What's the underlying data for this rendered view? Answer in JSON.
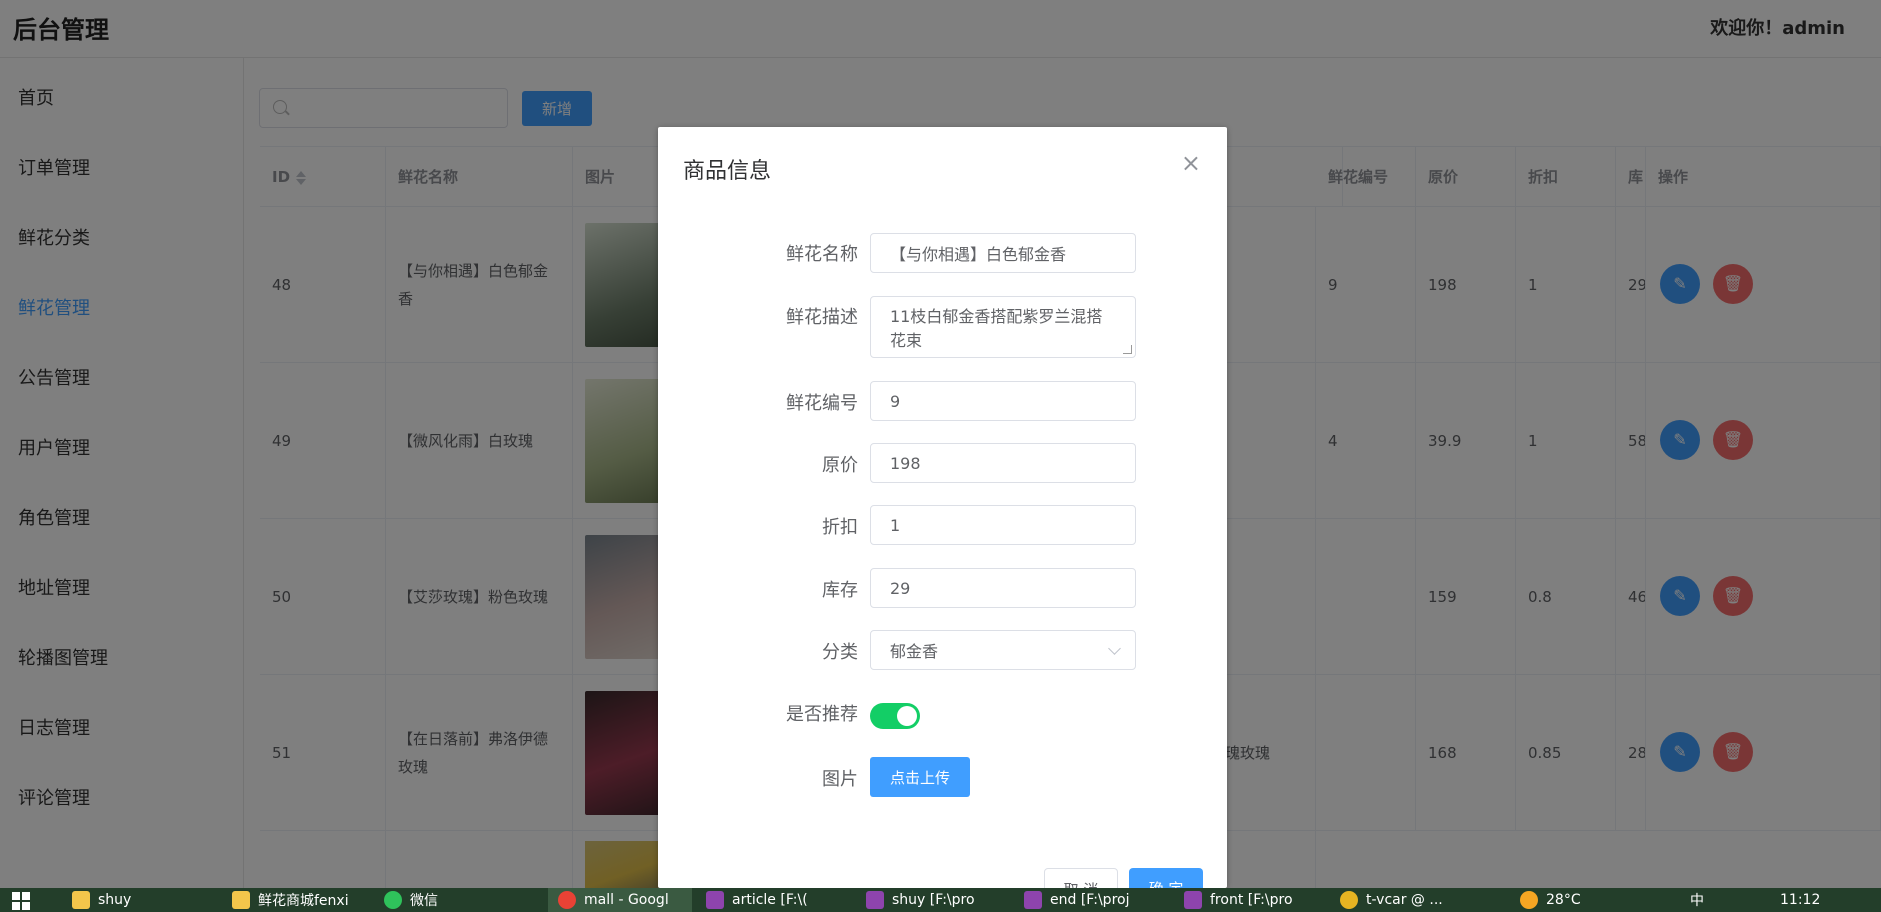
{
  "header": {
    "title": "后台管理",
    "welcome": "欢迎你！admin"
  },
  "sidebar": {
    "items": [
      {
        "label": "首页"
      },
      {
        "label": "订单管理"
      },
      {
        "label": "鲜花分类"
      },
      {
        "label": "鲜花管理",
        "active": true
      },
      {
        "label": "公告管理"
      },
      {
        "label": "用户管理"
      },
      {
        "label": "角色管理"
      },
      {
        "label": "地址管理"
      },
      {
        "label": "轮播图管理"
      },
      {
        "label": "日志管理"
      },
      {
        "label": "评论管理"
      }
    ]
  },
  "toolbar": {
    "search_placeholder": "",
    "add_label": "新增"
  },
  "table": {
    "headers": {
      "id": "ID",
      "name": "鲜花名称",
      "image": "图片",
      "code": "鲜花编号",
      "price": "原价",
      "discount": "折扣",
      "stock": "库存",
      "ops": "操作"
    },
    "rows": [
      {
        "id": "48",
        "name": "【与你相遇】白色郁金香",
        "col": "",
        "code": "9",
        "price": "198",
        "discount": "1",
        "stock": "29",
        "thumb_color": "#6e7f6b"
      },
      {
        "id": "49",
        "name": "【微风化雨】白玫瑰",
        "col": "",
        "code": "4",
        "price": "39.9",
        "discount": "1",
        "stock": "58",
        "thumb_color": "#a9b88a"
      },
      {
        "id": "50",
        "name": "【艾莎玫瑰】粉色玫瑰",
        "col": "",
        "code": "",
        "price": "159",
        "discount": "0.8",
        "stock": "46",
        "thumb_color": "#8f8a86"
      },
      {
        "id": "51",
        "name": "【在日落前】弗洛伊德玫瑰",
        "col": "瑰玫瑰",
        "code": "",
        "price": "168",
        "discount": "0.85",
        "stock": "28",
        "thumb_color": "#4a3034"
      }
    ]
  },
  "dialog": {
    "title": "商品信息",
    "close_icon": "×",
    "fields": {
      "name_label": "鲜花名称",
      "name_value": "【与你相遇】白色郁金香",
      "desc_label": "鲜花描述",
      "desc_value": "11枝白郁金香搭配紫罗兰混搭花束",
      "code_label": "鲜花编号",
      "code_value": "9",
      "price_label": "原价",
      "price_value": "198",
      "discount_label": "折扣",
      "discount_value": "1",
      "stock_label": "库存",
      "stock_value": "29",
      "category_label": "分类",
      "category_value": "郁金香",
      "recommend_label": "是否推荐",
      "recommend_on": true,
      "image_label": "图片",
      "upload_label": "点击上传"
    },
    "cancel_label": "取 消",
    "ok_label": "确 定"
  },
  "taskbar": {
    "items": [
      "shuy",
      "鲜花商城fenxi",
      "微信",
      "mall - Googl",
      "article [F:\\(",
      "shuy [F:\\pro",
      "end [F:\\proj",
      "front [F:\\pro",
      "t-vcar @ ..."
    ],
    "weather": "28°C",
    "time": "11:12",
    "ime": "中"
  },
  "colors": {
    "accent": "#409eff",
    "danger": "#f56c6c",
    "success": "#13ce66"
  }
}
